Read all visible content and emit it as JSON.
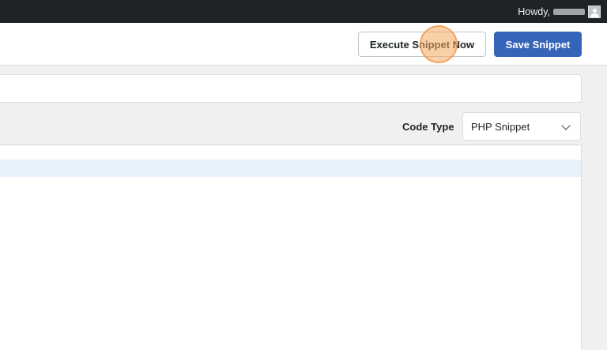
{
  "admin_bar": {
    "howdy_label": "Howdy,",
    "username": "",
    "avatar_icon": "user-avatar-icon"
  },
  "header": {
    "execute_button_label": "Execute Snippet Now",
    "save_button_label": "Save Snippet"
  },
  "snippet": {
    "title_value": "",
    "code_type_label": "Code Type",
    "code_type_selected": "PHP Snippet",
    "code_lines": [
      ""
    ]
  },
  "colors": {
    "admin_bar": "#1d2327",
    "primary_button": "#3664b8",
    "page_background": "#f0f0f1",
    "active_line_highlight": "#e8f2fd",
    "click_indicator": "#f6aa60"
  }
}
